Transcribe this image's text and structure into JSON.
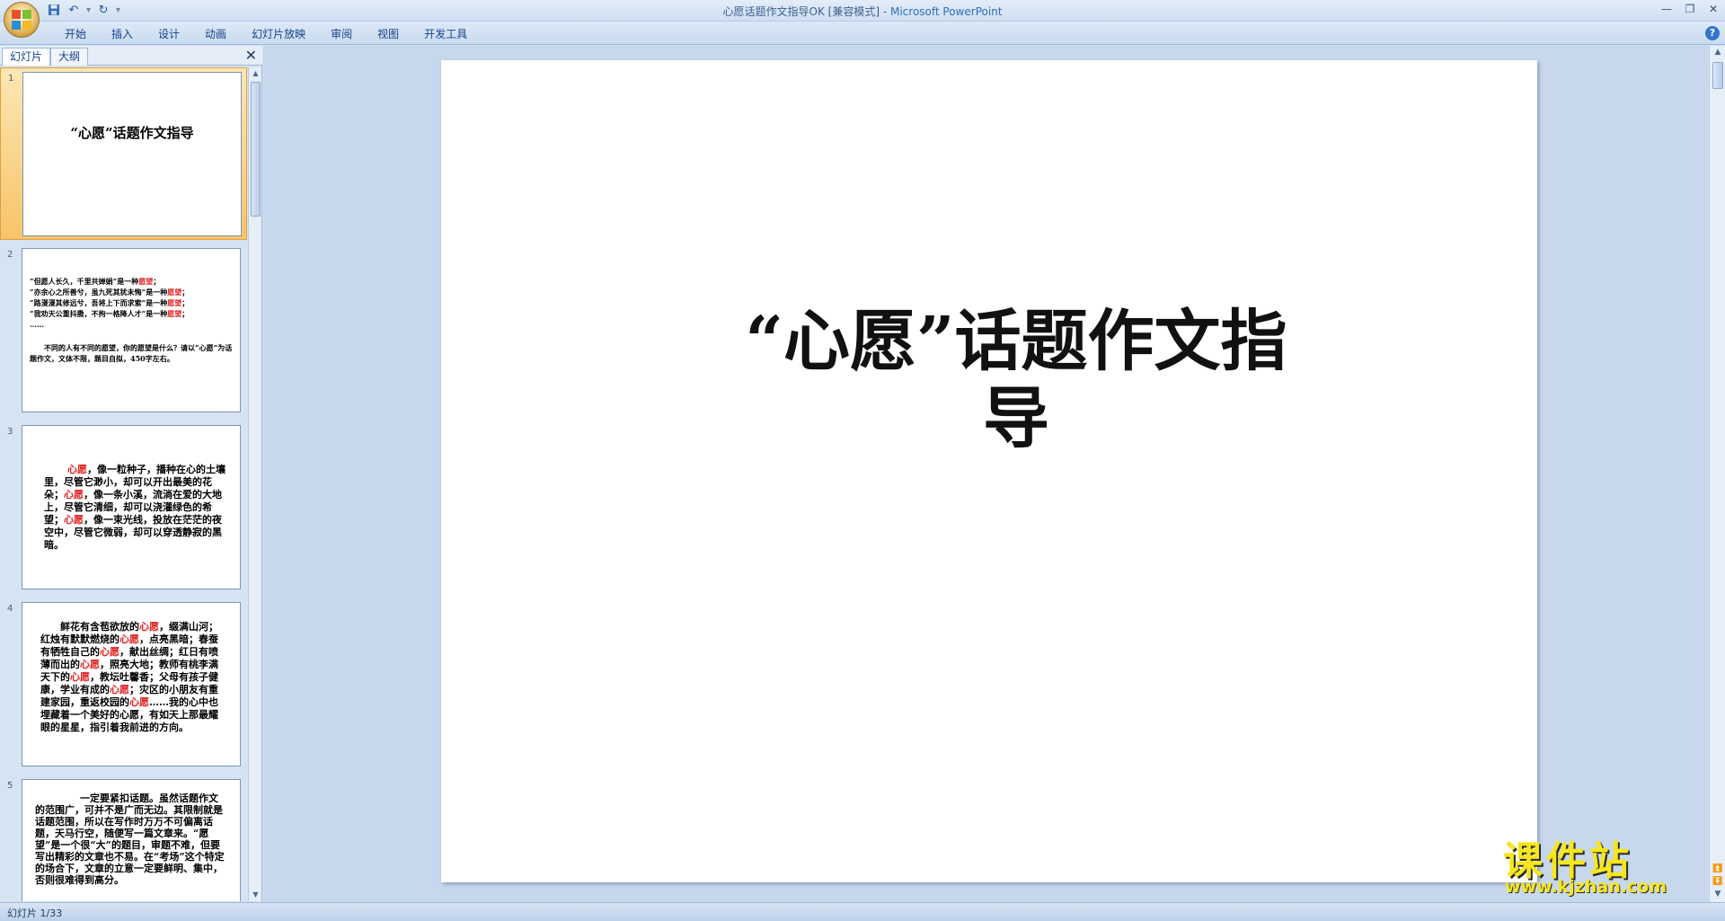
{
  "window": {
    "title_doc": "心愿话题作文指导OK [兼容模式]",
    "title_sep": " - ",
    "title_app": "Microsoft PowerPoint"
  },
  "ribbon": {
    "tabs": [
      "开始",
      "插入",
      "设计",
      "动画",
      "幻灯片放映",
      "审阅",
      "视图",
      "开发工具"
    ]
  },
  "pane": {
    "tab_slides": "幻灯片",
    "tab_outline": "大纲",
    "close": "✕"
  },
  "thumbnails": [
    {
      "num": "1",
      "title": "“心愿”话题作文指导"
    },
    {
      "num": "2",
      "lines": [
        [
          "“但愿人长久，千里共婵娟”是一种",
          "愿望",
          "；"
        ],
        [
          "“亦余心之所善兮，虽九死其犹未悔”是一种",
          "愿望",
          "；"
        ],
        [
          "“路漫漫其修远兮，吾将上下而求索”是一种",
          "愿望",
          "；"
        ],
        [
          "“我劝天公重抖擞，不拘一格降人才”是一种",
          "愿望",
          "；"
        ],
        [
          "……",
          "",
          ""
        ]
      ],
      "para": "不同的人有不同的愿望，你的愿望是什么？请以“心愿”为话题作文，文体不限，题目自拟，450字左右。"
    },
    {
      "num": "3",
      "segments": [
        "心愿",
        "，像一粒种子，播种在心的土壤里，尽管它渺小，却可以开出最美的花朵；",
        "心愿",
        "，像一条小溪，流淌在爱的大地上，尽管它清细，却可以浇灌绿色的希望；",
        "心愿",
        "，像一束光线，投放在茫茫的夜空中，尽管它微弱，却可以穿透静寂的黑暗。"
      ]
    },
    {
      "num": "4",
      "segments": [
        "鲜花有含苞欲放的",
        "心愿",
        "，缀满山河；红烛有默默燃烧的",
        "心愿",
        "，点亮黑暗；春蚕有牺牲自己的",
        "心愿",
        "，献出丝绸；红日有喷薄而出的",
        "心愿",
        "，照亮大地；教师有桃李满天下的",
        "心愿",
        "，教坛吐馨香；父母有孩子健康，学业有成的",
        "心愿",
        "；灾区的小朋友有重建家园，重返校园的",
        "心愿",
        "……我的心中也埋藏着一个美好的心愿，有如天上那最耀眼的星星，指引着我前进的方向。"
      ]
    },
    {
      "num": "5",
      "text": "一定要紧扣话题。虽然话题作文的范围广，可并不是广而无边。其限制就是话题范围，所以在写作时万万不可偏离话题，天马行空，随便写一篇文章来。“愿望”是一个很“大”的题目，审题不难，但要写出精彩的文章也不易。在“考场”这个特定的场合下，文章的立意一定要鲜明、集中，否则很难得到高分。"
    }
  ],
  "slide": {
    "title_line1": "“心愿”话题作文指",
    "title_line2": "导"
  },
  "status": {
    "slide_counter": "幻灯片 1/33"
  },
  "watermark": {
    "text": "课件站",
    "url": "www.kjzhan.com"
  },
  "colors": {
    "highlight_red": "#e02020",
    "watermark_yellow": "#f6e61a",
    "selected_thumb": "#f7c46a"
  }
}
